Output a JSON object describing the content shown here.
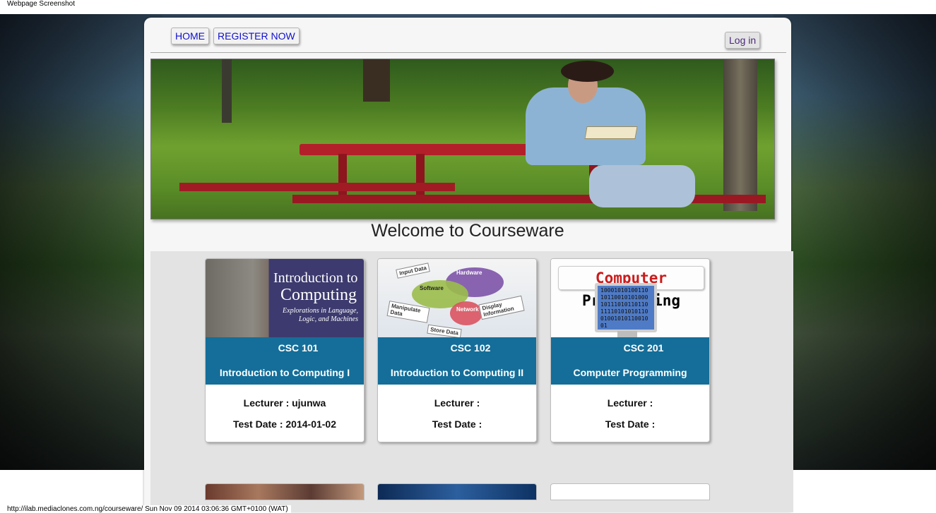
{
  "screenshot_label": "Webpage Screenshot",
  "nav": {
    "home": "HOME",
    "register": "REGISTER NOW",
    "login": "Log in"
  },
  "welcome_heading": "Welcome to Courseware",
  "courses": [
    {
      "code": "CSC 101",
      "title": "Introduction to Computing I",
      "lecturer": "Lecturer : ujunwa",
      "test_date": "Test Date : 2014-01-02",
      "thumb_text": {
        "line1": "Introduction to",
        "line2": "Computing",
        "line3": "Explorations in Language, Logic, and Machines"
      }
    },
    {
      "code": "CSC 102",
      "title": "Introduction to Computing II",
      "lecturer": "Lecturer :",
      "test_date": "Test Date :",
      "thumb_text": {
        "input": "Input Data",
        "hardware": "Hardware",
        "software": "Software",
        "display": "Display Information",
        "manipulate": "Manipulate Data",
        "network": "Network",
        "store": "Store Data"
      }
    },
    {
      "code": "CSC 201",
      "title": "Computer Programming",
      "lecturer": "Lecturer :",
      "test_date": "Test Date :",
      "thumb_text": {
        "word1": "Computer",
        "word2": "Programming",
        "binary": "100010101001101011001010100010111010110110111101010101100100101011001001"
      }
    }
  ],
  "status_bar": "http://ilab.mediaclones.com.ng/courseware/ Sun Nov 09 2014 03:06:36 GMT+0100 (WAT)",
  "colors": {
    "course_band": "#146e99",
    "nav_link": "#1010cc",
    "login_text": "#4b2a7a"
  }
}
